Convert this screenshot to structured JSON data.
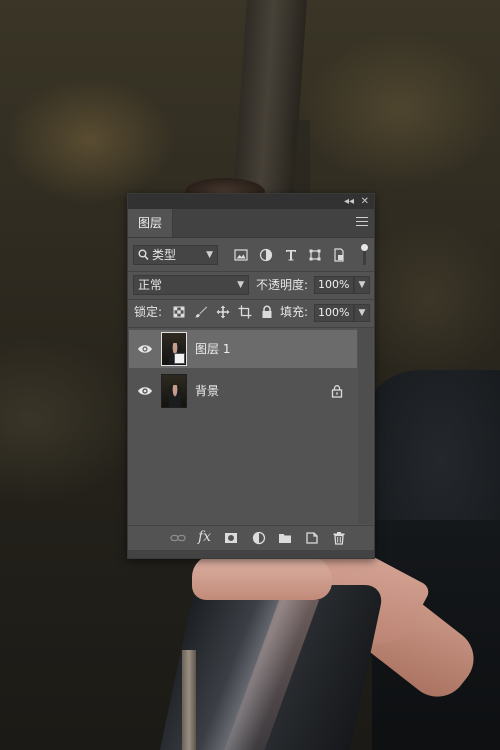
{
  "panel": {
    "tab_label": "图层",
    "collapse_glyph": "◂◂",
    "close_glyph": "✕"
  },
  "filter": {
    "kind_label": "类型",
    "icons": [
      "image-filter-icon",
      "adjustment-filter-icon",
      "type-filter-icon",
      "shape-filter-icon",
      "smart-object-filter-icon"
    ]
  },
  "blend": {
    "mode": "正常",
    "opacity_label": "不透明度:",
    "opacity_value": "100%"
  },
  "lock_row": {
    "lock_label": "锁定:",
    "fill_label": "填充:",
    "fill_value": "100%"
  },
  "layers": [
    {
      "name": "图层 1",
      "visible": true,
      "selected": true,
      "smart_object": true,
      "locked": false
    },
    {
      "name": "背景",
      "visible": true,
      "selected": false,
      "smart_object": false,
      "locked": true
    }
  ],
  "bottom_icons": [
    "link-layers-icon",
    "fx-icon",
    "mask-icon",
    "adjustment-layer-icon",
    "group-folder-icon",
    "new-layer-icon",
    "trash-icon"
  ],
  "bottom_fx_label": "fx"
}
